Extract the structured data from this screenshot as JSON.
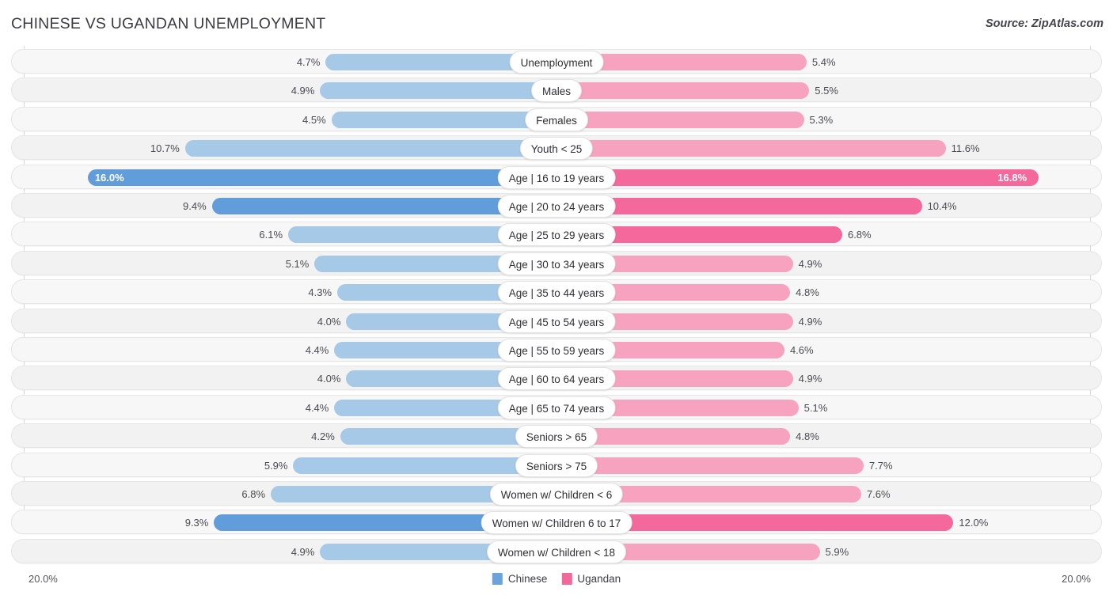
{
  "header": {
    "title": "CHINESE VS UGANDAN UNEMPLOYMENT",
    "source": "Source: ZipAtlas.com"
  },
  "legend": {
    "items": [
      {
        "label": "Chinese",
        "color": "#6ba3dc"
      },
      {
        "label": "Ugandan",
        "color": "#f2689c"
      }
    ]
  },
  "axis": {
    "left_label": "20.0%",
    "right_label": "20.0%",
    "max": 20.0
  },
  "colors": {
    "left_normal": "#a6c9e8",
    "left_highlight": "#629ddb",
    "right_normal": "#f7a3c0",
    "right_highlight": "#f4689b",
    "row_bg": "#f7f7f7",
    "row_bg_alt": "#f2f2f2",
    "text": "#4b4b52"
  },
  "chart_data": {
    "type": "bar",
    "title": "CHINESE VS UGANDAN UNEMPLOYMENT",
    "subtitle": "Source: ZipAtlas.com",
    "orientation": "horizontal-diverging",
    "xlabel": "",
    "ylabel": "",
    "xlim": [
      20.0,
      20.0
    ],
    "grid": true,
    "legend_position": "bottom-center",
    "series": [
      {
        "name": "Chinese",
        "color": "#a6c9e8",
        "values": [
          4.7,
          4.9,
          4.5,
          10.7,
          16.0,
          9.4,
          6.1,
          5.1,
          4.3,
          4.0,
          4.4,
          4.0,
          4.4,
          4.2,
          5.9,
          6.8,
          9.3,
          4.9
        ]
      },
      {
        "name": "Ugandan",
        "color": "#f7a3c0",
        "values": [
          5.4,
          5.5,
          5.3,
          11.6,
          16.8,
          10.4,
          6.8,
          4.9,
          4.8,
          4.9,
          4.6,
          4.9,
          5.1,
          4.8,
          7.7,
          7.6,
          12.0,
          5.9
        ]
      }
    ],
    "categories": [
      "Unemployment",
      "Males",
      "Females",
      "Youth < 25",
      "Age | 16 to 19 years",
      "Age | 20 to 24 years",
      "Age | 25 to 29 years",
      "Age | 30 to 34 years",
      "Age | 35 to 44 years",
      "Age | 45 to 54 years",
      "Age | 55 to 59 years",
      "Age | 60 to 64 years",
      "Age | 65 to 74 years",
      "Seniors > 65",
      "Seniors > 75",
      "Women w/ Children < 6",
      "Women w/ Children 6 to 17",
      "Women w/ Children < 18"
    ]
  },
  "rows": [
    {
      "category": "Unemployment",
      "left_value": 4.7,
      "left_label": "4.7%",
      "right_value": 5.4,
      "right_label": "5.4%",
      "highlight": false
    },
    {
      "category": "Males",
      "left_value": 4.9,
      "left_label": "4.9%",
      "right_value": 5.5,
      "right_label": "5.5%",
      "highlight": false
    },
    {
      "category": "Females",
      "left_value": 4.5,
      "left_label": "4.5%",
      "right_value": 5.3,
      "right_label": "5.3%",
      "highlight": false
    },
    {
      "category": "Youth < 25",
      "left_value": 10.7,
      "left_label": "10.7%",
      "right_value": 11.6,
      "right_label": "11.6%",
      "highlight": false
    },
    {
      "category": "Age | 16 to 19 years",
      "left_value": 16.0,
      "left_label": "16.0%",
      "right_value": 16.8,
      "right_label": "16.8%",
      "highlight": true
    },
    {
      "category": "Age | 20 to 24 years",
      "left_value": 9.4,
      "left_label": "9.4%",
      "right_value": 10.4,
      "right_label": "10.4%",
      "highlight": true
    },
    {
      "category": "Age | 25 to 29 years",
      "left_value": 6.1,
      "left_label": "6.1%",
      "right_value": 6.8,
      "right_label": "6.8%",
      "highlight": true
    },
    {
      "category": "Age | 30 to 34 years",
      "left_value": 5.1,
      "left_label": "5.1%",
      "right_value": 4.9,
      "right_label": "4.9%",
      "highlight": false
    },
    {
      "category": "Age | 35 to 44 years",
      "left_value": 4.3,
      "left_label": "4.3%",
      "right_value": 4.8,
      "right_label": "4.8%",
      "highlight": false
    },
    {
      "category": "Age | 45 to 54 years",
      "left_value": 4.0,
      "left_label": "4.0%",
      "right_value": 4.9,
      "right_label": "4.9%",
      "highlight": false
    },
    {
      "category": "Age | 55 to 59 years",
      "left_value": 4.4,
      "left_label": "4.4%",
      "right_value": 4.6,
      "right_label": "4.6%",
      "highlight": false
    },
    {
      "category": "Age | 60 to 64 years",
      "left_value": 4.0,
      "left_label": "4.0%",
      "right_value": 4.9,
      "right_label": "4.9%",
      "highlight": false
    },
    {
      "category": "Age | 65 to 74 years",
      "left_value": 4.4,
      "left_label": "4.4%",
      "right_value": 5.1,
      "right_label": "5.1%",
      "highlight": false
    },
    {
      "category": "Seniors > 65",
      "left_value": 4.2,
      "left_label": "4.2%",
      "right_value": 4.8,
      "right_label": "4.8%",
      "highlight": false
    },
    {
      "category": "Seniors > 75",
      "left_value": 5.9,
      "left_label": "5.9%",
      "right_value": 7.7,
      "right_label": "7.7%",
      "highlight": false
    },
    {
      "category": "Women w/ Children < 6",
      "left_value": 6.8,
      "left_label": "6.8%",
      "right_value": 7.6,
      "right_label": "7.6%",
      "highlight": false
    },
    {
      "category": "Women w/ Children 6 to 17",
      "left_value": 9.3,
      "left_label": "9.3%",
      "right_value": 12.0,
      "right_label": "12.0%",
      "highlight": true
    },
    {
      "category": "Women w/ Children < 18",
      "left_value": 4.9,
      "left_label": "4.9%",
      "right_value": 5.9,
      "right_label": "5.9%",
      "highlight": false
    }
  ]
}
